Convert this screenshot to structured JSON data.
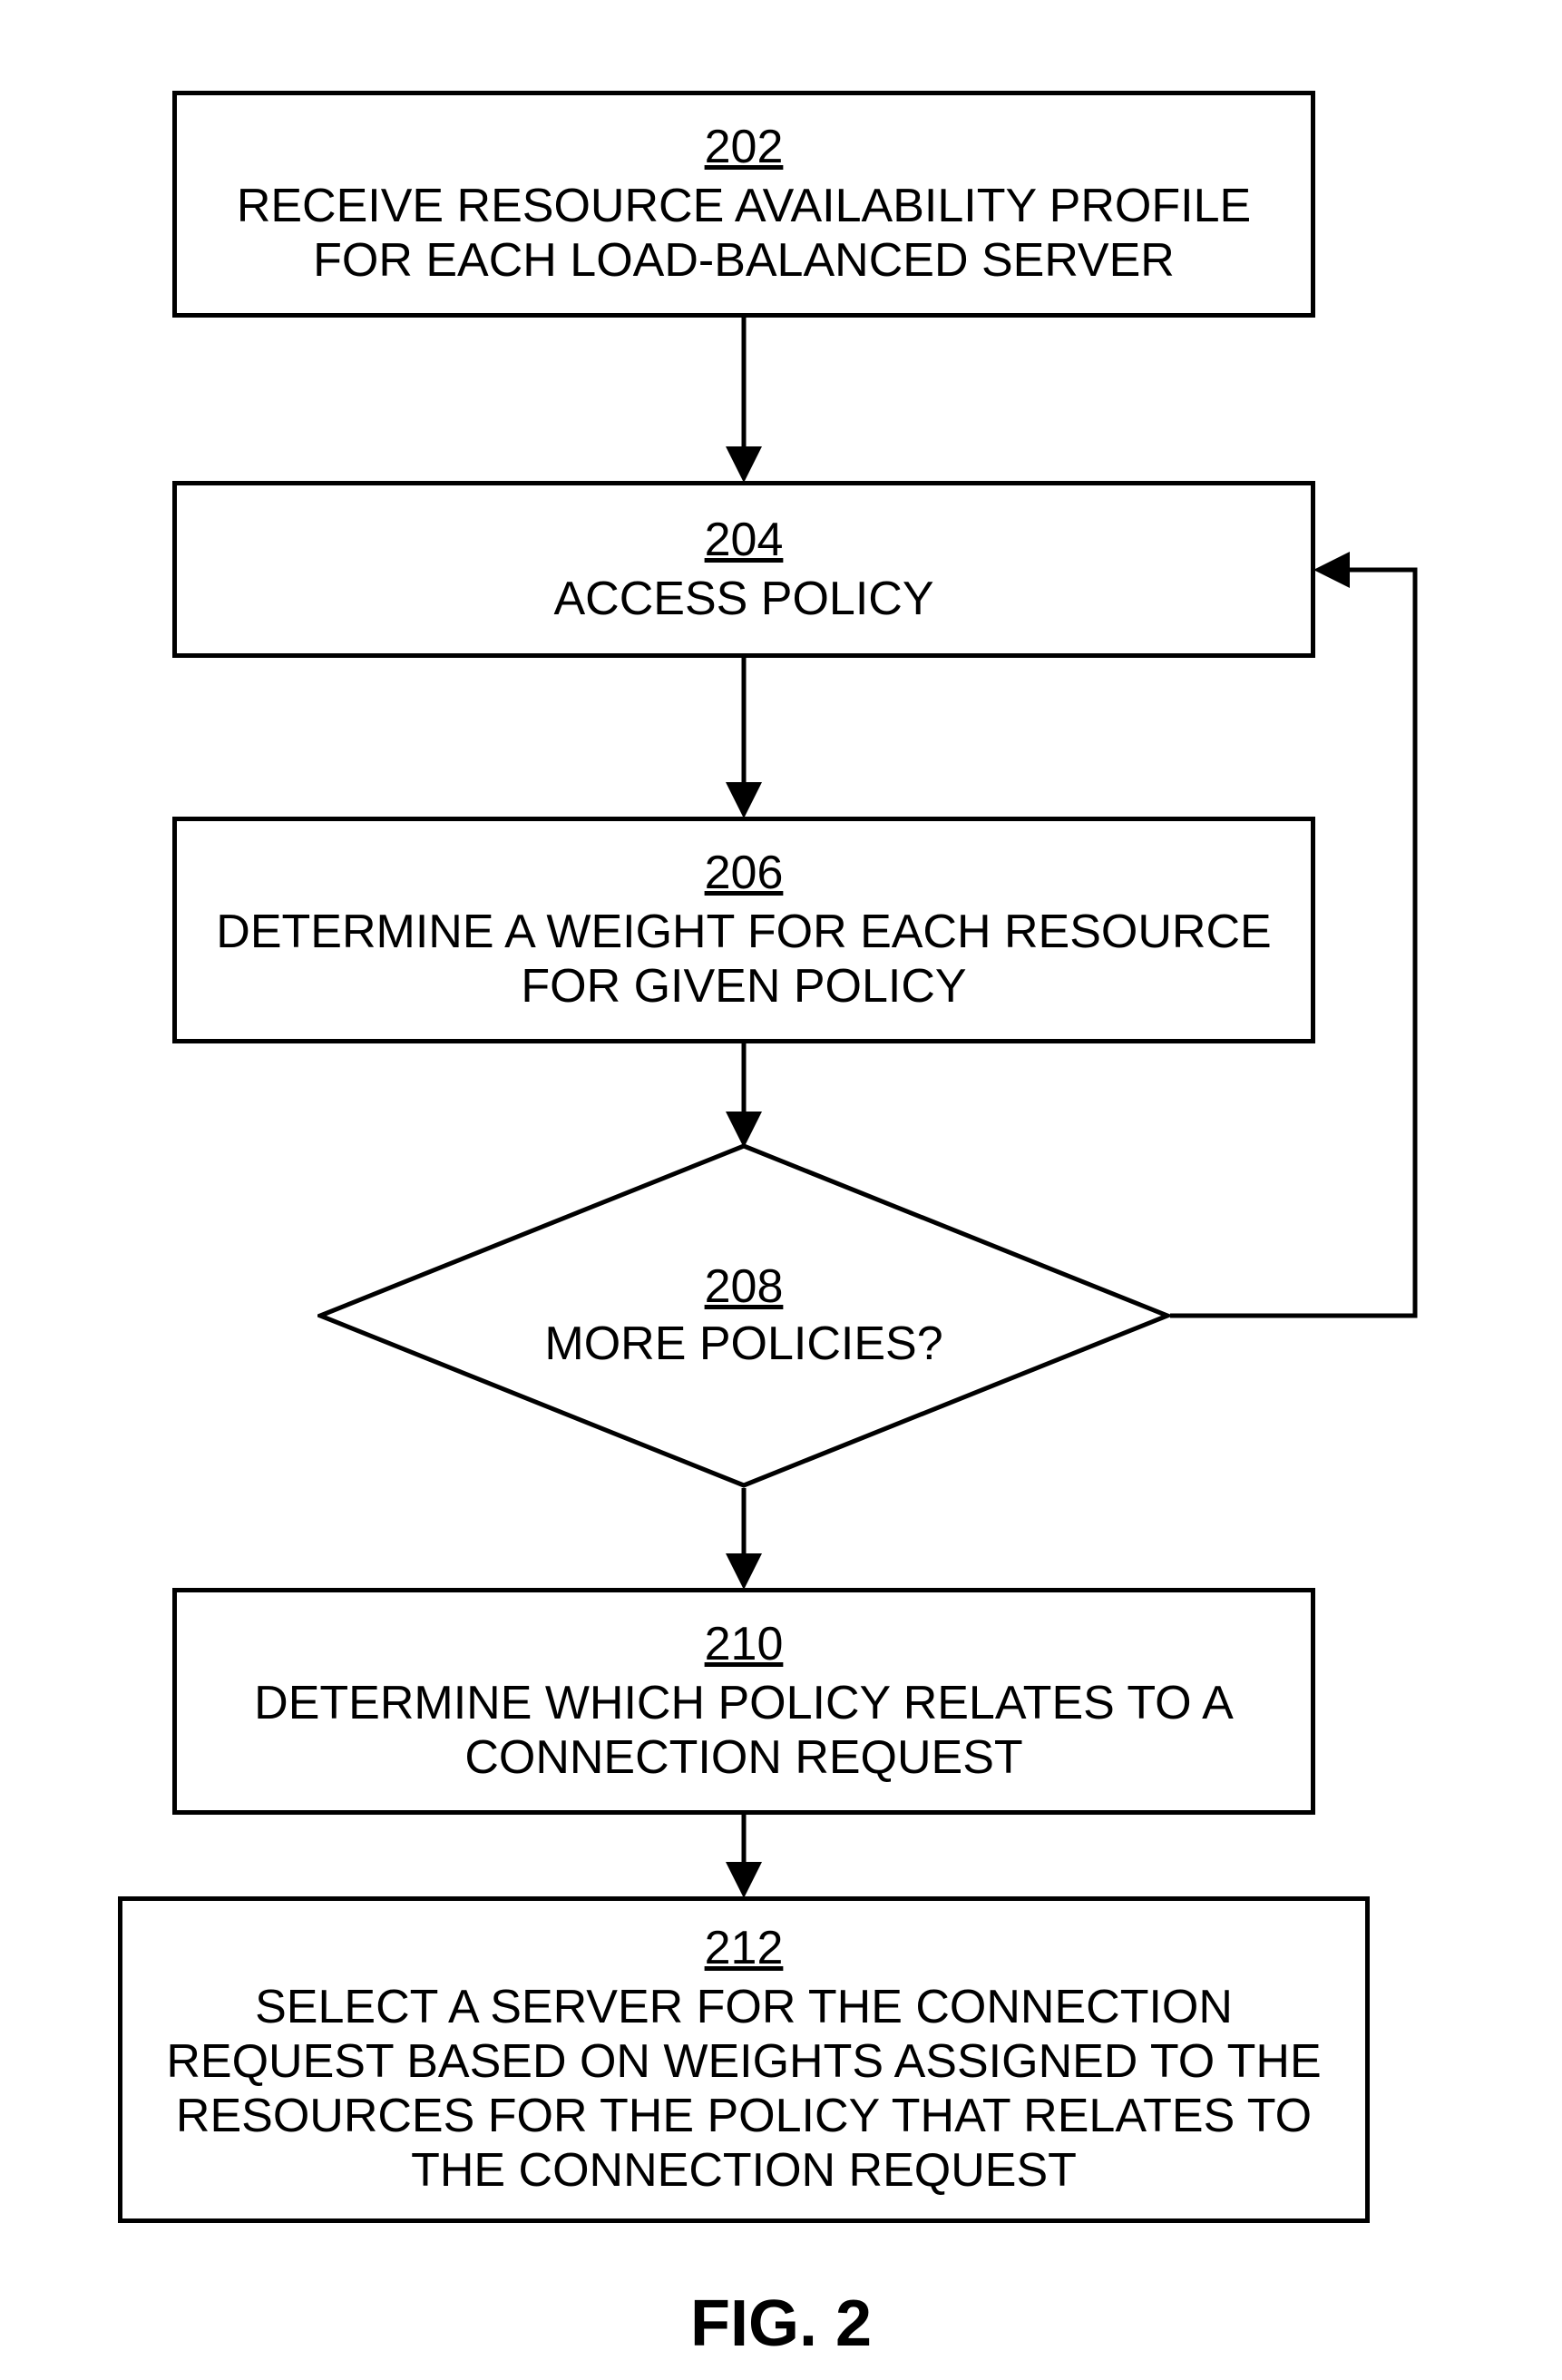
{
  "figure_label": "FIG. 2",
  "nodes": {
    "n202": {
      "num": "202",
      "text": "RECEIVE RESOURCE AVAILABILITY PROFILE FOR EACH LOAD-BALANCED SERVER"
    },
    "n204": {
      "num": "204",
      "text": "ACCESS POLICY"
    },
    "n206": {
      "num": "206",
      "text": "DETERMINE A WEIGHT FOR EACH RESOURCE FOR GIVEN POLICY"
    },
    "n208": {
      "num": "208",
      "text": "MORE POLICIES?"
    },
    "n210": {
      "num": "210",
      "text": "DETERMINE WHICH POLICY RELATES TO A CONNECTION REQUEST"
    },
    "n212": {
      "num": "212",
      "text": "SELECT A SERVER FOR THE CONNECTION REQUEST BASED ON WEIGHTS ASSIGNED TO THE RESOURCES FOR THE POLICY THAT RELATES TO THE CONNECTION REQUEST"
    }
  }
}
